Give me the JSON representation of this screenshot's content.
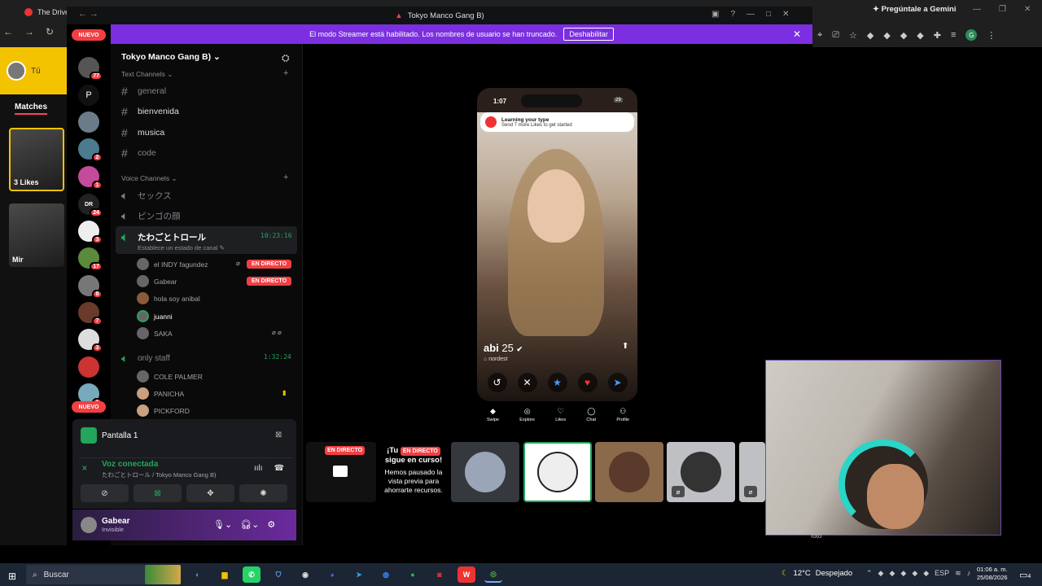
{
  "chrome": {
    "tab_title": "The Drive",
    "gemini_label": "Pregúntale a Gemini",
    "profile_letter": "G"
  },
  "tinder": {
    "user_label": "Tú",
    "matches_tab": "Matches",
    "match1_label": "3 Likes",
    "match2_label": "Mir"
  },
  "discord": {
    "window_title": "Tokyo Manco Gang B)",
    "streamer_banner": "El modo Streamer está habilitado. Los nombres de usuario se han truncado.",
    "disable_button": "Deshabilitar",
    "nuevo_badge": "NUEVO",
    "server_letter": "P",
    "server_label_dr": "DR",
    "server_badges": [
      "2",
      "77",
      "2",
      "1",
      "24",
      "3",
      "17",
      "8",
      "7",
      "3",
      "1"
    ],
    "server_name": "Tokyo Manco Gang B)",
    "text_category": "Text Channels",
    "text_channels": [
      "general",
      "bienvenida",
      "musica",
      "code"
    ],
    "voice_category": "Voice Channels",
    "voice_channels": [
      "セックス",
      "ピンゴの顔"
    ],
    "active_voice": {
      "name": "たわごとトロール",
      "timer": "10:23:16",
      "status": "Establece un estado de canal"
    },
    "voice_users": [
      "el INDY fagundez",
      "Gabear",
      "hola soy anibal",
      "juanni",
      "SAKA"
    ],
    "live_label": "EN DIRECTO",
    "staff_channel": {
      "name": "only staff",
      "timer": "1:32:24"
    },
    "staff_users": [
      "COLE PALMER",
      "PANICHA",
      "PICKFORD"
    ],
    "screen_label": "Pantalla 1",
    "voice_connected": "Voz conectada",
    "voice_connected_sub": "たわごとトロール / Tokyo Manco Gang B)",
    "user": {
      "name": "Gabear",
      "status": "Invisible"
    },
    "paused": {
      "title_prefix": "¡Tu",
      "title_suffix": "sigue en curso!",
      "body": "Hemos pausado la vista previa para ahorrarte recursos."
    }
  },
  "phone": {
    "time": "1:07",
    "battery": "29",
    "learn_title": "Learning your type",
    "learn_sub": "Send 7 more Likes to get started",
    "name": "abi",
    "age": "25",
    "location": "nordest",
    "nav": [
      "Swipe",
      "Explore",
      "Likes",
      "Chat",
      "Profile"
    ]
  },
  "webcam": {
    "label": "foto"
  },
  "taskbar": {
    "search": "Buscar",
    "temperature": "12°C",
    "weather": "Despejado",
    "lang": "ESP",
    "time": "01:06 a. m.",
    "date": "25/08/2026",
    "notif_count": "4"
  },
  "colors": {
    "discord_purple": "#7b2fe0",
    "live_red": "#f23f43",
    "voice_green": "#23a55a",
    "tinder_yellow": "#f3c300"
  }
}
